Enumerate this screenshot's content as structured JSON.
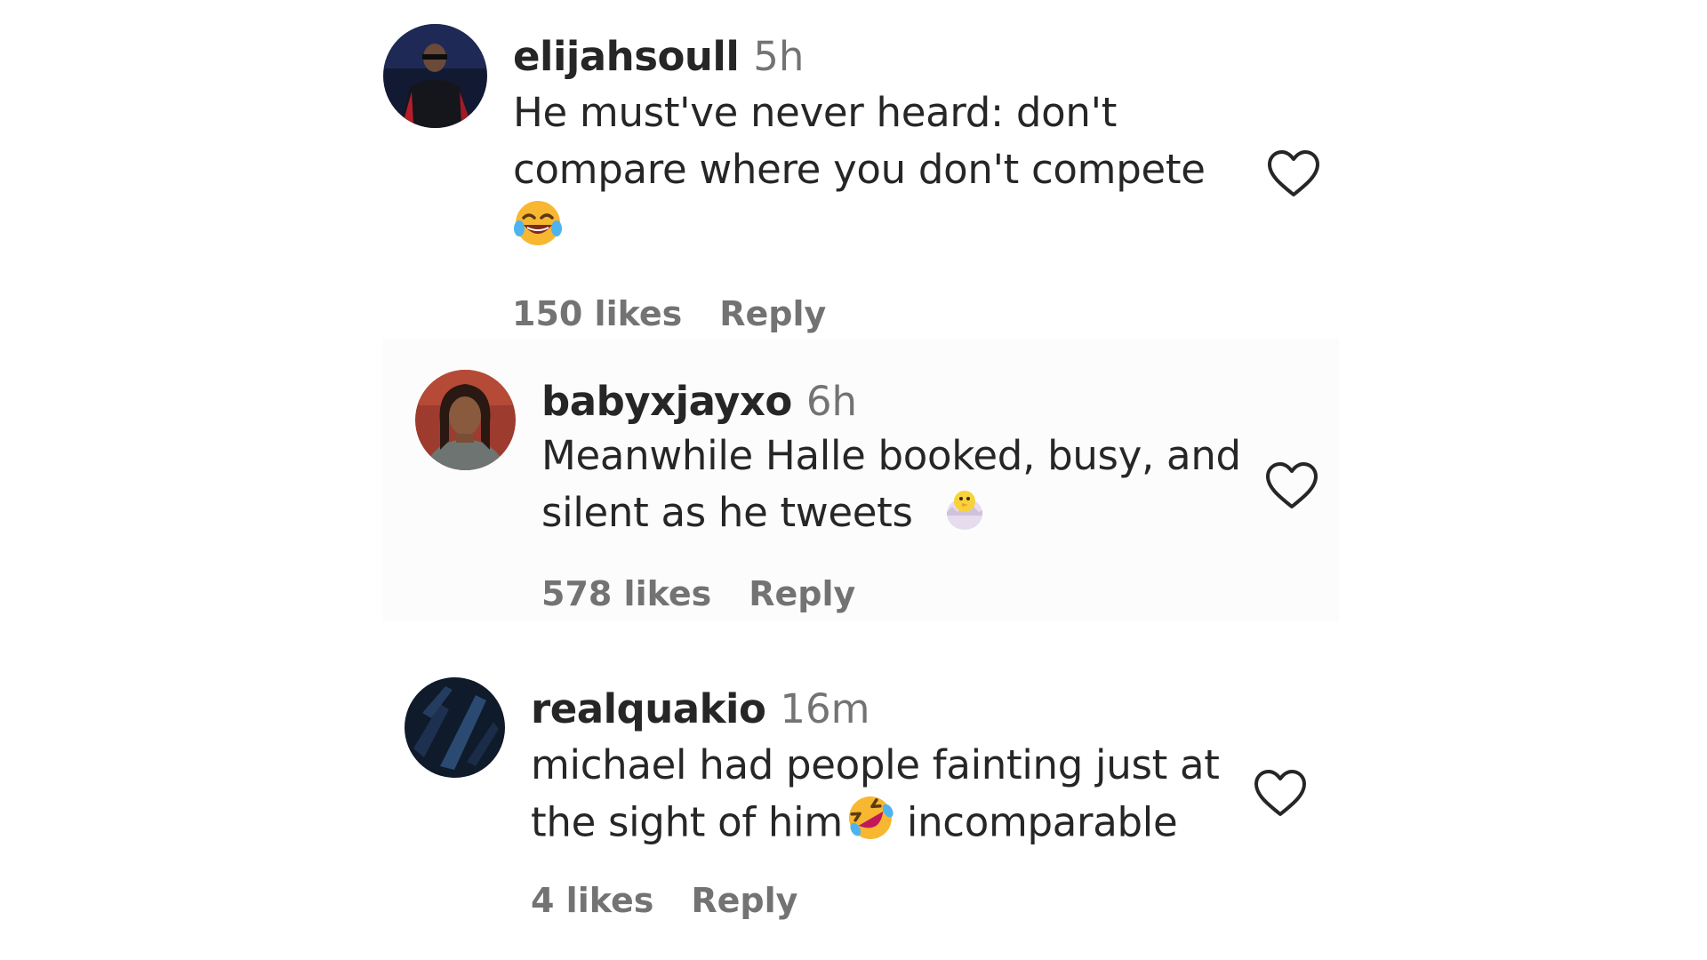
{
  "comments": [
    {
      "username": "elijahsoull",
      "time": "5h",
      "text_lines": [
        "He must've never heard: don't",
        "compare where you don't compete"
      ],
      "emoji": "tears-of-joy-emoji",
      "likes": "150 likes",
      "reply_label": "Reply"
    },
    {
      "username": "babyxjayxo",
      "time": "6h",
      "text_lines": [
        "Meanwhile Halle booked, busy, and",
        "silent as he tweets"
      ],
      "emoji": "hatching-chick-emoji",
      "likes": "578 likes",
      "reply_label": "Reply"
    },
    {
      "username": "realquakio",
      "time": "16m",
      "text_lines": [
        "michael had people fainting just at",
        "the sight of him"
      ],
      "text_after_emoji": " incomparable",
      "emoji": "rolling-on-floor-laughing-emoji",
      "likes": "4 likes",
      "reply_label": "Reply"
    }
  ],
  "icons": {
    "like": "heart-outline-icon"
  },
  "colors": {
    "text_primary": "#262626",
    "text_secondary": "#737373",
    "background": "#ffffff"
  }
}
